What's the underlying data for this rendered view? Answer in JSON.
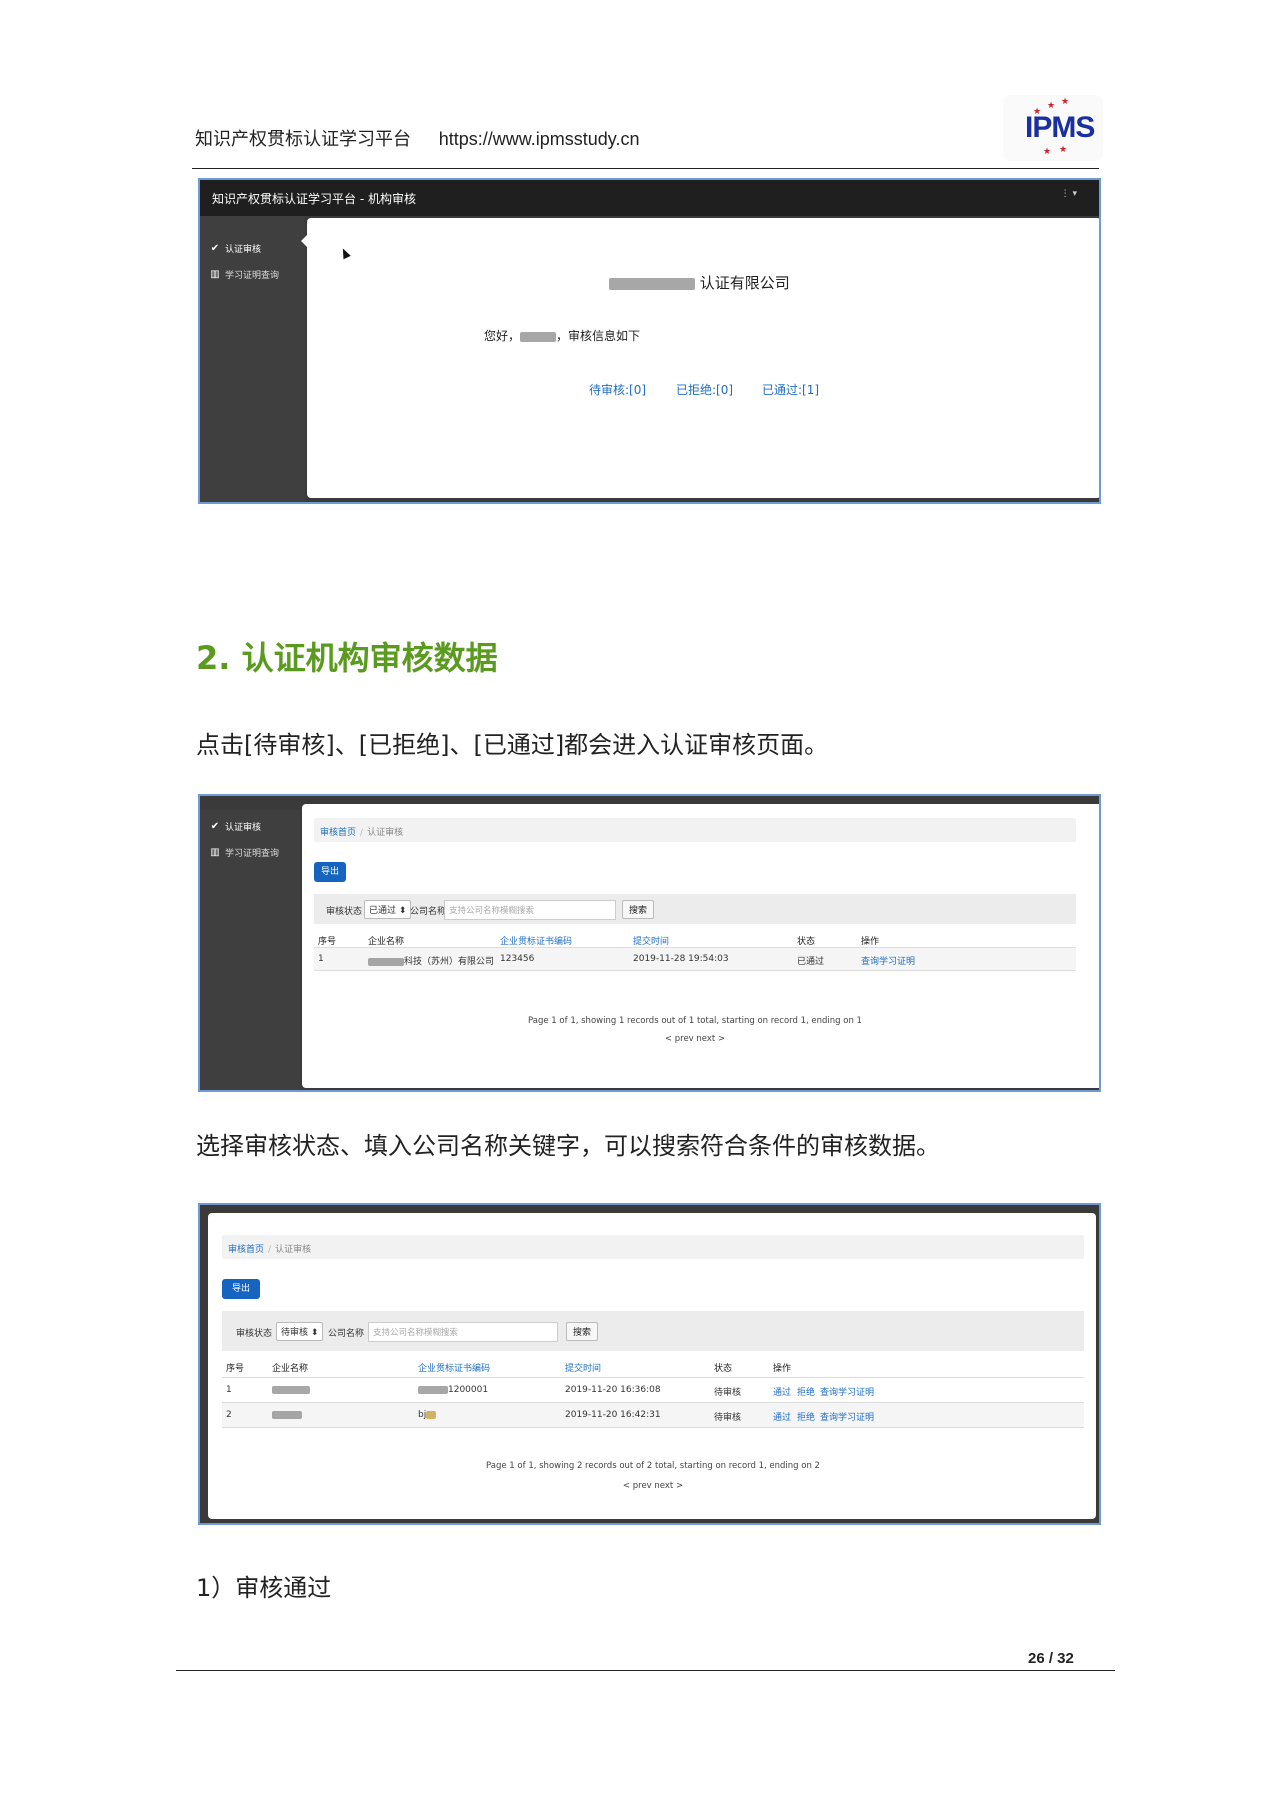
{
  "header": {
    "platform_name": "知识产权贯标认证学习平台",
    "url": "https://www.ipmsstudy.cn",
    "logo_text": "IPMS"
  },
  "screenshot1": {
    "topbar_title": "知识产权贯标认证学习平台 - 机构审核",
    "topbar_menu": "▾",
    "sidebar": [
      "认证审核",
      "学习证明查询"
    ],
    "company_suffix": "认证有限公司",
    "greeting_prefix": "您好，",
    "greeting_suffix": "，审核信息如下",
    "links": [
      "待审核:[0]",
      "已拒绝:[0]",
      "已通过:[1]"
    ]
  },
  "section": {
    "heading": "2. 认证机构审核数据",
    "para1": "点击[待审核]、[已拒绝]、[已通过]都会进入认证审核页面。",
    "para2": "选择审核状态、填入公司名称关键字，可以搜索符合条件的审核数据。",
    "para3": "1）审核通过"
  },
  "screenshot2": {
    "sidebar": [
      "认证审核",
      "学习证明查询"
    ],
    "breadcrumb": [
      "审核首页",
      "认证审核"
    ],
    "export_label": "导出",
    "filter": {
      "status_label": "审核状态",
      "status_value": "已通过 ⬍",
      "company_label": "公司名称",
      "placeholder": "支持公司名称模糊搜索",
      "search_label": "搜索"
    },
    "columns": [
      "序号",
      "企业名称",
      "企业贯标证书编码",
      "提交时间",
      "状态",
      "操作"
    ],
    "rows": [
      [
        "1",
        "科技（苏州）有限公司",
        "123456",
        "2019-11-28 19:54:03",
        "已通过",
        "查询学习证明"
      ]
    ],
    "pager_info": "Page 1 of 1, showing 1 records out of 1 total, starting on record 1, ending on 1",
    "pager_nav": "< prev next >"
  },
  "screenshot3": {
    "breadcrumb": [
      "审核首页",
      "认证审核"
    ],
    "export_label": "导出",
    "filter": {
      "status_label": "审核状态",
      "status_value": "待审核 ⬍",
      "company_label": "公司名称",
      "placeholder": "支持公司名称模糊搜索",
      "search_label": "搜索"
    },
    "columns": [
      "序号",
      "企业名称",
      "企业贯标证书编码",
      "提交时间",
      "状态",
      "操作"
    ],
    "rows": [
      {
        "no": "1",
        "cert": "1200001",
        "time": "2019-11-20 16:36:08",
        "status": "待审核",
        "actions": [
          "通过",
          "拒绝",
          "查询学习证明"
        ]
      },
      {
        "no": "2",
        "cert": "bj",
        "time": "2019-11-20 16:42:31",
        "status": "待审核",
        "actions": [
          "通过",
          "拒绝",
          "查询学习证明"
        ]
      }
    ],
    "pager_info": "Page 1 of 1, showing 2 records out of 2 total, starting on record 1, ending on 2",
    "pager_nav": "< prev next >"
  },
  "footer": {
    "page": "26 / 32"
  },
  "colors": {
    "heading_green": "#5a9a1e",
    "link_blue": "#1f6fc4",
    "export_blue": "#1565c0",
    "frame_border": "#6e9ad6"
  }
}
